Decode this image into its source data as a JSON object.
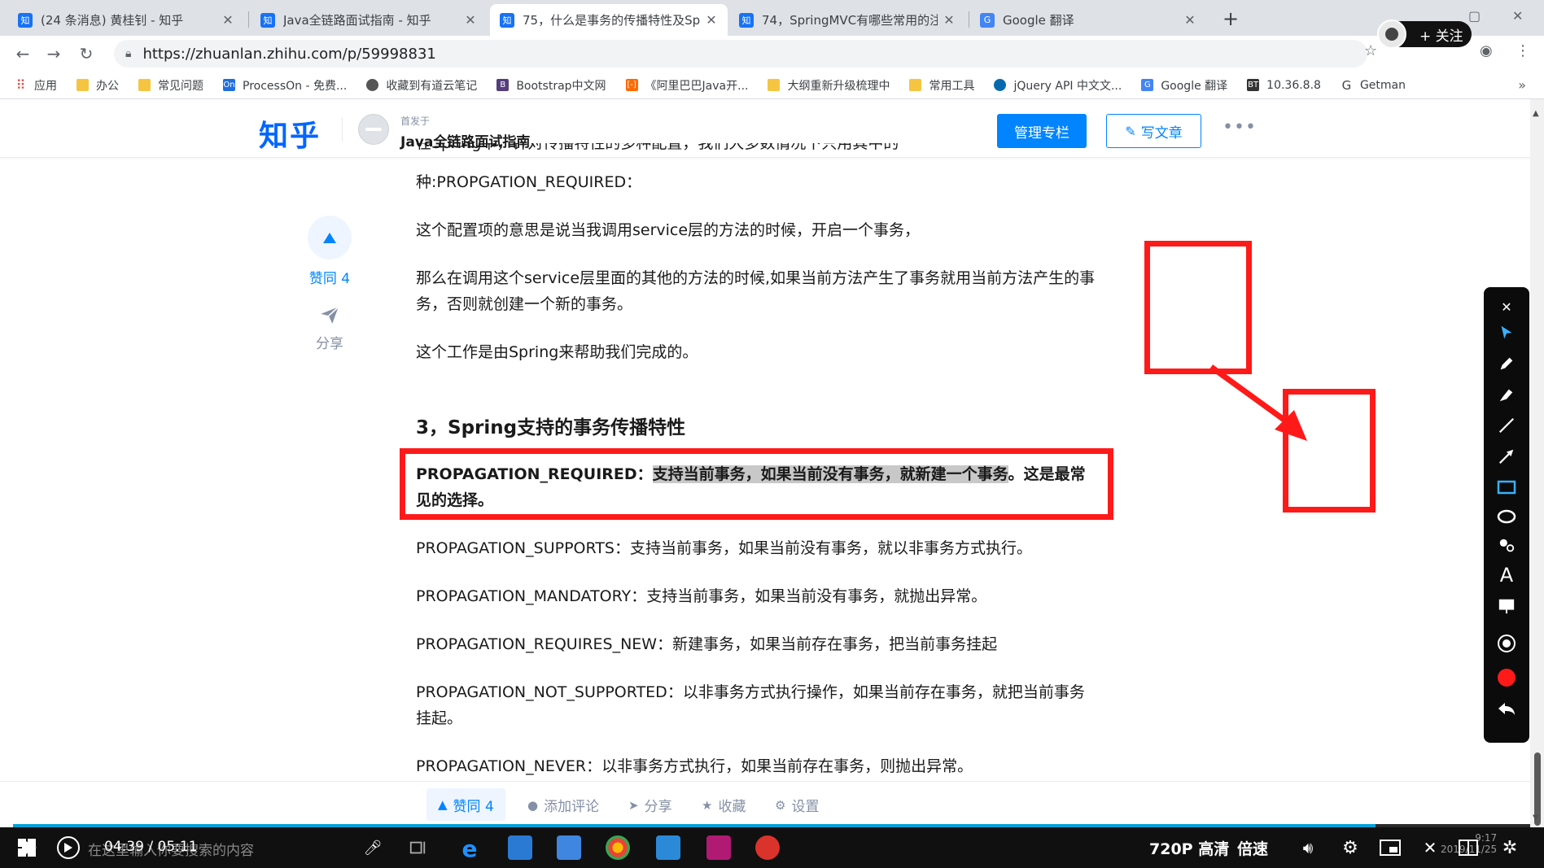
{
  "browser": {
    "tabs": [
      {
        "favicon": "知",
        "title": "(24 条消息) 黄桂钊 - 知乎"
      },
      {
        "favicon": "知",
        "title": "Java全链路面试指南 - 知乎"
      },
      {
        "favicon": "知",
        "title": "75，什么是事务的传播特性及Sp"
      },
      {
        "favicon": "知",
        "title": "74，SpringMVC有哪些常用的注"
      },
      {
        "favicon": "G",
        "title": "Google 翻译"
      }
    ],
    "url": "https://zhuanlan.zhihu.com/p/59998831",
    "follow_button": "+ 关注",
    "bookmarks": [
      "应用",
      "办公",
      "常见问题",
      "ProcessOn - 免费...",
      "收藏到有道云笔记",
      "Bootstrap中文网",
      "《阿里巴巴Java开...",
      "大纲重新升级梳理中",
      "常用工具",
      "jQuery API 中文文...",
      "Google 翻译",
      "10.36.8.8",
      "Getman"
    ],
    "bookmark_more": "»"
  },
  "header": {
    "logo": "知乎",
    "published_label": "首发于",
    "column_name": "Java全链路面试指南",
    "manage_button": "管理专栏",
    "write_button": "写文章",
    "more": "•••"
  },
  "side_actions": {
    "upvote_label": "赞同 4",
    "share_label": "分享"
  },
  "article": {
    "cut_line": "在Spring中，针对传播特性的多种配置，我们大多数情况下只用其中的一",
    "p1": "种:PROPGATION_REQUIRED：",
    "p2": "这个配置项的意思是说当我调用service层的方法的时候，开启一个事务，",
    "p3": "那么在调用这个service层里面的其他的方法的时候,如果当前方法产生了事务就用当前方法产生的事务，否则就创建一个新的事务。",
    "p4": "这个工作是由Spring来帮助我们完成的。",
    "heading": "3，Spring支持的事务传播特性",
    "required_name": "PROPAGATION_REQUIRED：",
    "required_marked": "支持当前事务，如果当前没有事务，就新建一个事务",
    "required_tail": "。这是最常见的选择。",
    "supports": "PROPAGATION_SUPPORTS：支持当前事务，如果当前没有事务，就以非事务方式执行。",
    "mandatory": "PROPAGATION_MANDATORY：支持当前事务，如果当前没有事务，就抛出异常。",
    "requires_new": "PROPAGATION_REQUIRES_NEW：新建事务，如果当前存在事务，把当前事务挂起",
    "not_supported": "PROPAGATION_NOT_SUPPORTED：以非事务方式执行操作，如果当前存在事务，就把当前事务挂起。",
    "never": "PROPAGATION_NEVER：以非事务方式执行，如果当前存在事务，则抛出异常。"
  },
  "action_bar": {
    "vote": "赞同 4",
    "comment": "添加评论",
    "share": "分享",
    "favorite": "收藏",
    "settings": "设置"
  },
  "video": {
    "time": "04:39 / 05:11",
    "search_placeholder": "在这里输入你要搜索的内容",
    "quality": "720P 高清",
    "speed": "倍速",
    "progress": 0.898
  },
  "clock": {
    "time": "9:17",
    "date": "2019/11/25"
  },
  "colors": {
    "zhihu_blue": "#0084ff",
    "annotation_red": "#ff1a1a",
    "progress_blue": "#00a1d6"
  }
}
